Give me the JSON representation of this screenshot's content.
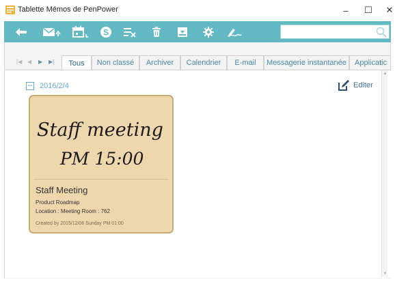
{
  "window": {
    "title": "Tablette Mémos de PenPower",
    "minimize_glyph": "–",
    "maximize_glyph": "☐",
    "close_glyph": "✕"
  },
  "toolbar": {
    "icons": [
      "back-arrow-icon",
      "email-send-icon",
      "calendar-icon",
      "skype-icon",
      "list-clear-icon",
      "trash-icon",
      "archive-icon",
      "gear-icon",
      "pen-sign-icon"
    ],
    "search_placeholder": "",
    "search_value": "",
    "accent_color": "#62b9c4"
  },
  "tabs": {
    "nav": [
      "|◀",
      "◀",
      "▶",
      "▶|"
    ],
    "items": [
      {
        "label": "Tous",
        "active": true
      },
      {
        "label": "Non classé",
        "active": false
      },
      {
        "label": "Archiver",
        "active": false
      },
      {
        "label": "Calendrier",
        "active": false
      },
      {
        "label": "E-mail",
        "active": false
      },
      {
        "label": "Messagerie instantanée",
        "active": false
      },
      {
        "label": "Applicatic",
        "active": false
      }
    ]
  },
  "group": {
    "collapse_glyph": "–",
    "date": "2016/2/4",
    "edit_label": "Editer"
  },
  "memo": {
    "handwriting_line1": "Staff meeting",
    "handwriting_line2": "PM 15:00",
    "title": "Staff Meeting",
    "line1": "Product Roadmap",
    "line2": "Location : Meeting Room : 762",
    "created": "Created by 2015/12/06 Sunday PM 01:00",
    "background_color": "#efd7ad",
    "border_color": "#c9a870"
  }
}
